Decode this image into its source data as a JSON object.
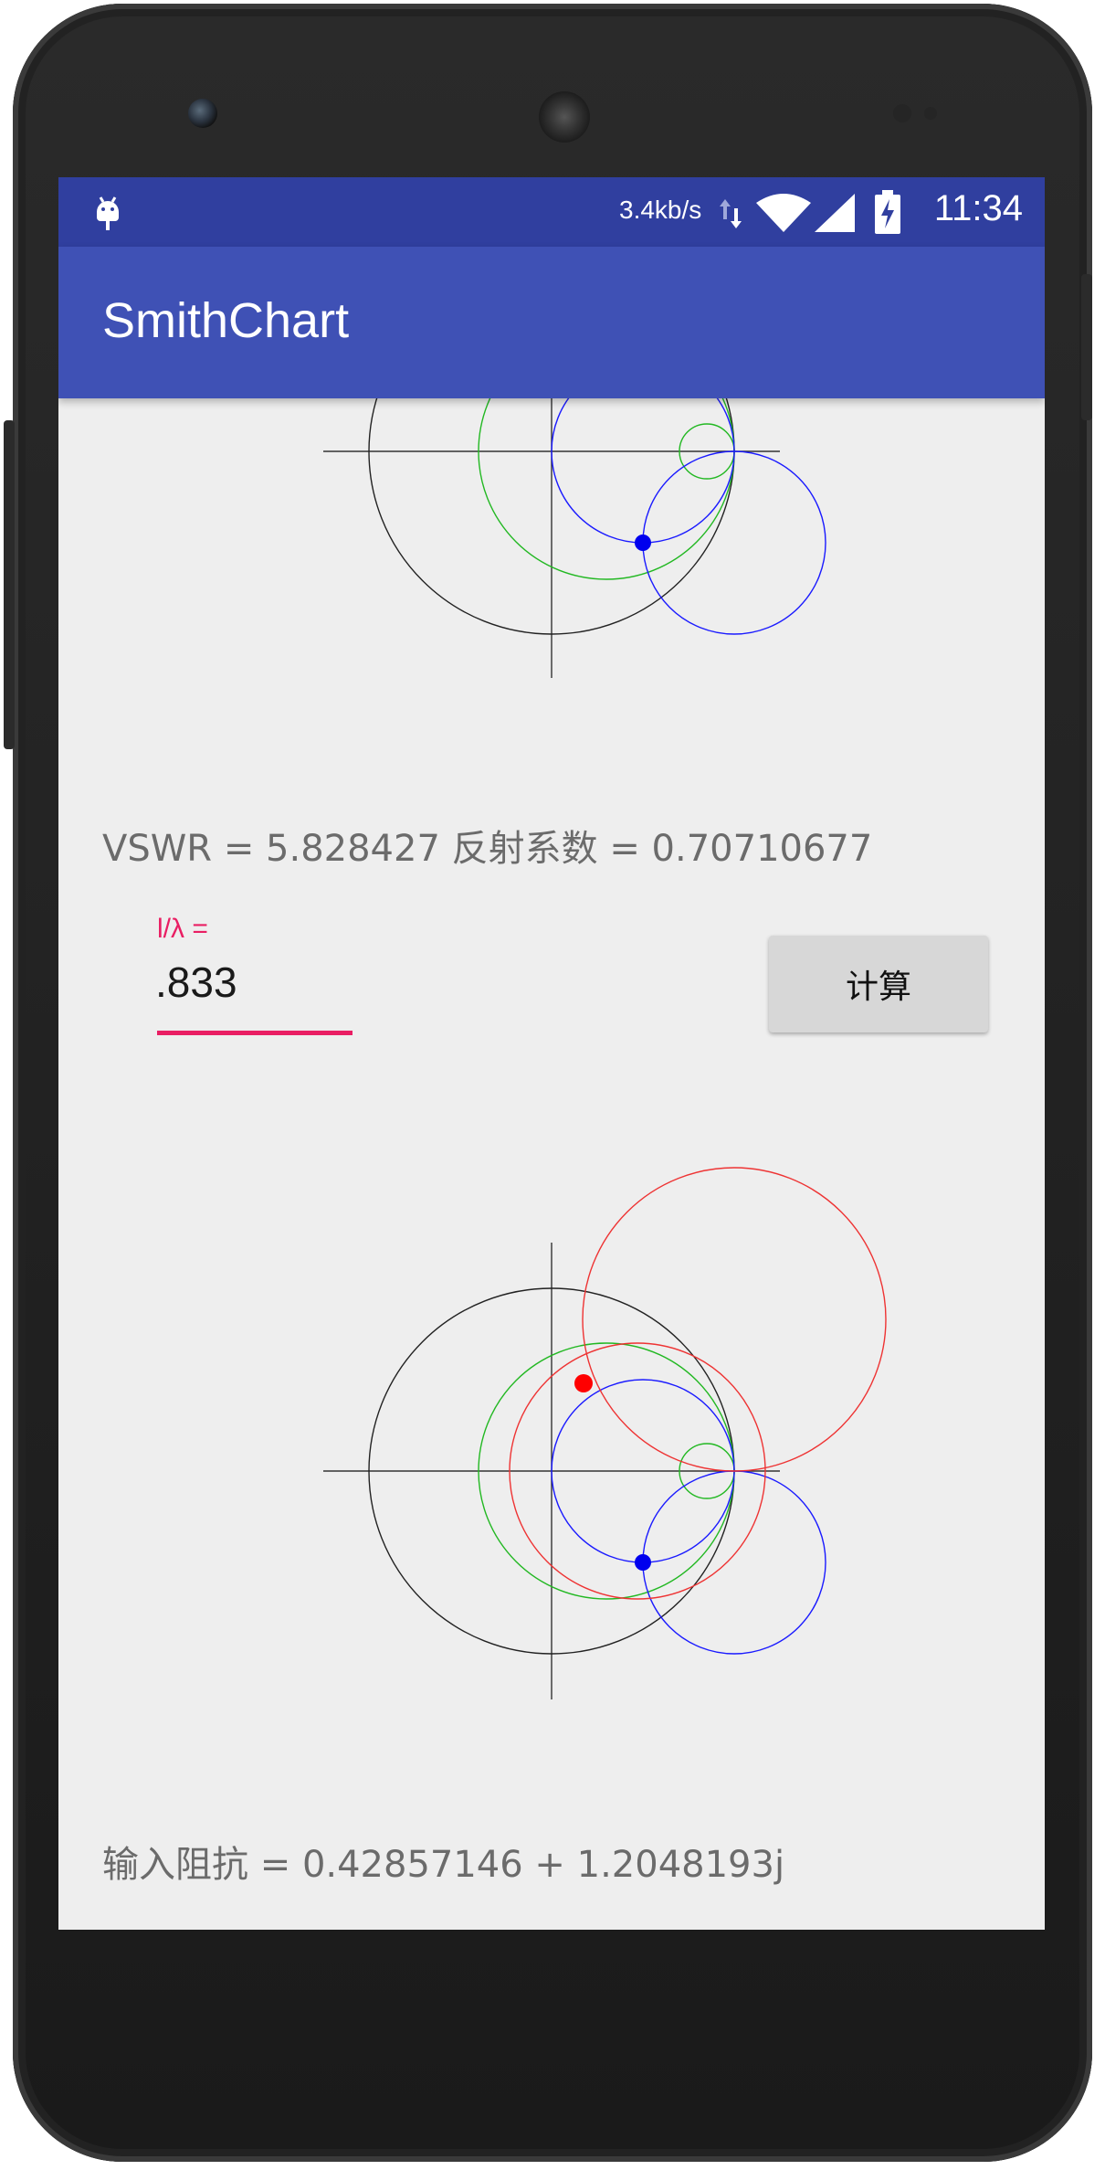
{
  "status_bar": {
    "net_speed": "3.4kb/s",
    "time": "11:34",
    "icons": [
      "android-debug-icon",
      "data-transfer-icon",
      "wifi-icon",
      "signal-icon",
      "battery-charging-icon"
    ]
  },
  "app_bar": {
    "title": "SmithChart"
  },
  "results": {
    "vswr_line": "VSWR = 5.828427   反射系数 = 0.70710677",
    "impedance_line": "输入阻抗 = 0.42857146 + 1.2048193j"
  },
  "input": {
    "label": "l/λ =",
    "value": ".833"
  },
  "button": {
    "label": "计算"
  },
  "colors": {
    "status_bar": "#303f9f",
    "app_bar": "#3f51b5",
    "accent": "#e91e63",
    "background": "#eeeeee",
    "resistance_circle": "#00c000",
    "load_circles": "#0000ff",
    "input_circles": "#ff0000",
    "unit_circle": "#000000"
  }
}
